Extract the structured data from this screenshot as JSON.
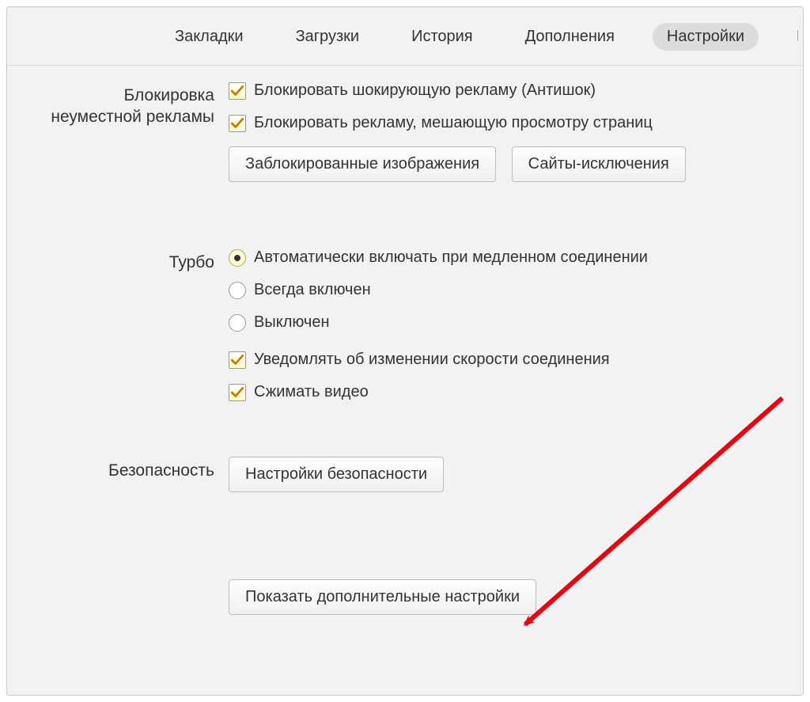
{
  "nav": {
    "tabs": [
      {
        "label": "Закладки",
        "active": false
      },
      {
        "label": "Загрузки",
        "active": false
      },
      {
        "label": "История",
        "active": false
      },
      {
        "label": "Дополнения",
        "active": false
      },
      {
        "label": "Настройки",
        "active": true
      }
    ],
    "cut_tab_letter": "Б"
  },
  "sections": {
    "ad_block": {
      "title_line1": "Блокировка",
      "title_line2": "неуместной рекламы",
      "check_antishock": "Блокировать шокирующую рекламу (Антишок)",
      "check_interfering": "Блокировать рекламу, мешающую просмотру страниц",
      "btn_blocked_images": "Заблокированные изображения",
      "btn_site_exceptions": "Сайты-исключения"
    },
    "turbo": {
      "title": "Турбо",
      "radio_auto": "Автоматически включать при медленном соединении",
      "radio_always": "Всегда включен",
      "radio_off": "Выключен",
      "check_notify": "Уведомлять об изменении скорости соединения",
      "check_compress": "Сжимать видео"
    },
    "security": {
      "title": "Безопасность",
      "btn_settings": "Настройки безопасности"
    },
    "advanced": {
      "btn_show": "Показать дополнительные настройки"
    }
  },
  "colors": {
    "arrow": "#e30613"
  }
}
